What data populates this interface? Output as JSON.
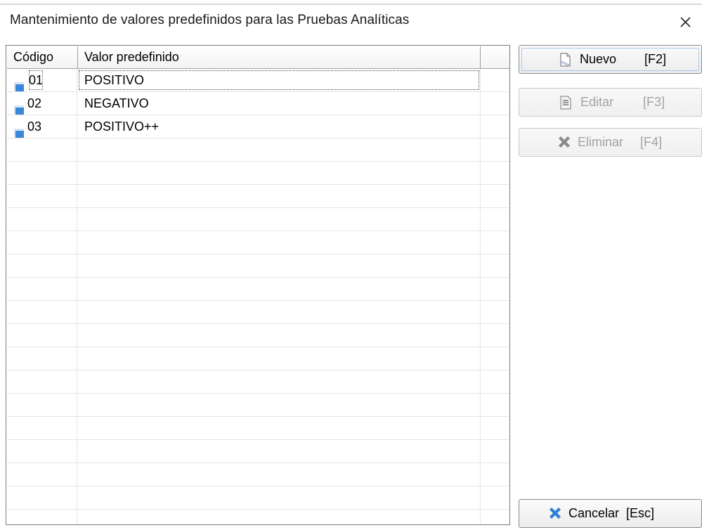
{
  "window": {
    "title": "Mantenimiento de valores predefinidos para las Pruebas Analíticas",
    "close_icon": "close-icon"
  },
  "grid": {
    "columns": [
      "Código",
      "Valor predefinido",
      ""
    ],
    "rows": [
      {
        "code": "01",
        "value": "POSITIVO",
        "selected": true
      },
      {
        "code": "02",
        "value": "NEGATIVO",
        "selected": false
      },
      {
        "code": "03",
        "value": "POSITIVO++",
        "selected": false
      }
    ],
    "empty_row_count": 17
  },
  "buttons": {
    "new": {
      "label": "Nuevo",
      "shortcut": "[F2]",
      "icon": "new-document-icon",
      "enabled": true
    },
    "edit": {
      "label": "Editar",
      "shortcut": "[F3]",
      "icon": "edit-document-icon",
      "enabled": false
    },
    "delete": {
      "label": "Eliminar",
      "shortcut": "[F4]",
      "icon": "delete-x-icon",
      "enabled": false
    },
    "cancel": {
      "label": "Cancelar",
      "shortcut": "[Esc]",
      "icon": "cancel-x-icon",
      "enabled": true
    }
  },
  "colors": {
    "row_icon": "#3a86d8",
    "delete_icon_disabled": "#8a8a8a",
    "cancel_icon": "#2f7fd6"
  }
}
